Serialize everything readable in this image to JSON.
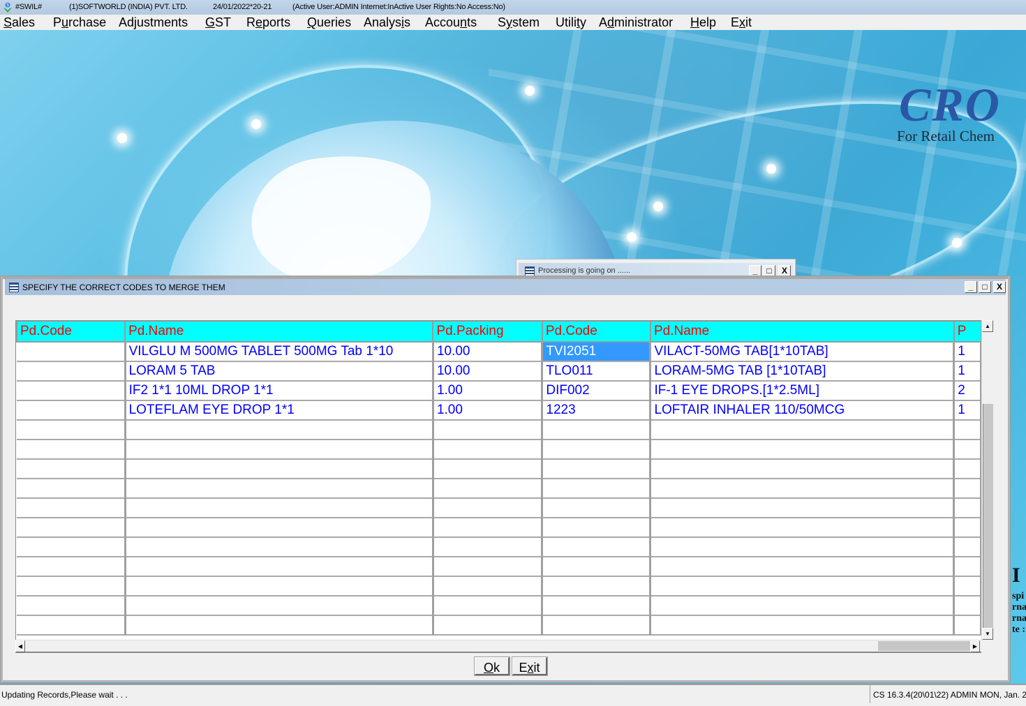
{
  "titlebar": {
    "app_name": "#SWIL#",
    "company": "(1)SOFTWORLD (INDIA) PVT. LTD.",
    "date_year": "24/01/2022*20-21",
    "status": "(Active User:ADMIN Internet:InActive User Rights:No Access:No)"
  },
  "menu": [
    {
      "label": "Sales",
      "hotkey_index": 0
    },
    {
      "label": "Purchase",
      "hotkey_index": 1
    },
    {
      "label": "Adjustments",
      "hotkey_index": 2
    },
    {
      "label": "GST",
      "hotkey_index": 0
    },
    {
      "label": "Reports",
      "hotkey_index": 1
    },
    {
      "label": "Queries",
      "hotkey_index": 0
    },
    {
      "label": "Analysis",
      "hotkey_index": 6
    },
    {
      "label": "Accounts",
      "hotkey_index": 5
    },
    {
      "label": "System",
      "hotkey_index": 1
    },
    {
      "label": "Utility",
      "hotkey_index": 5
    },
    {
      "label": "Administrator",
      "hotkey_index": 1
    },
    {
      "label": "Help",
      "hotkey_index": 0
    },
    {
      "label": "Exit",
      "hotkey_index": 1
    }
  ],
  "background": {
    "brand": "CRO",
    "tagline": "For Retail Chem",
    "side_fragments": [
      "I",
      "spi",
      "rna",
      "rna",
      "te :"
    ]
  },
  "processing_window": {
    "title": "Processing is going on ......",
    "buttons": {
      "minimize": "_",
      "maximize": "□",
      "close": "X"
    }
  },
  "dialog": {
    "title": "SPECIFY THE CORRECT CODES TO MERGE THEM",
    "buttons": {
      "minimize": "_",
      "maximize": "□",
      "close": "X"
    },
    "grid": {
      "columns": [
        "Pd.Code",
        "Pd.Name",
        "Pd.Packing",
        "Pd.Code",
        "Pd.Name",
        "P"
      ],
      "rows": [
        [
          "",
          "VILGLU M 500MG TABLET 500MG Tab 1*10",
          "10.00",
          "TVI2051",
          "VILACT-50MG TAB[1*10TAB]",
          "1"
        ],
        [
          "",
          "LORAM 5 TAB",
          "10.00",
          "TLO011",
          "LORAM-5MG TAB [1*10TAB]",
          "1"
        ],
        [
          "",
          "IF2 1*1 10ML DROP 1*1",
          "1.00",
          "DIF002",
          "IF-1 EYE DROPS.[1*2.5ML]",
          "2"
        ],
        [
          "",
          "LOTEFLAM EYE DROP 1*1",
          "1.00",
          "1223",
          "LOFTAIR INHALER 110/50MCG",
          "1"
        ],
        [
          "",
          "",
          "",
          "",
          "",
          ""
        ],
        [
          "",
          "",
          "",
          "",
          "",
          ""
        ],
        [
          "",
          "",
          "",
          "",
          "",
          ""
        ],
        [
          "",
          "",
          "",
          "",
          "",
          ""
        ],
        [
          "",
          "",
          "",
          "",
          "",
          ""
        ],
        [
          "",
          "",
          "",
          "",
          "",
          ""
        ],
        [
          "",
          "",
          "",
          "",
          "",
          ""
        ],
        [
          "",
          "",
          "",
          "",
          "",
          ""
        ],
        [
          "",
          "",
          "",
          "",
          "",
          ""
        ],
        [
          "",
          "",
          "",
          "",
          "",
          ""
        ],
        [
          "",
          "",
          "",
          "",
          "",
          ""
        ]
      ],
      "selected_cell": {
        "row": 0,
        "col": 3
      }
    },
    "ok_label": "Ok",
    "ok_hotkey_index": 0,
    "exit_label": "Exit",
    "exit_hotkey_index": 1
  },
  "statusbar": {
    "message": "Updating Records,Please wait . . .",
    "info": "CS 16.3.4(20\\01\\22) ADMIN  MON, Jan. 2"
  },
  "colors": {
    "grid_header_bg": "#00ffff",
    "grid_header_text": "#ff0000",
    "grid_cell_text": "#0000ff",
    "selection_bg": "#3399ff",
    "brand_text": "#2a58a6"
  }
}
